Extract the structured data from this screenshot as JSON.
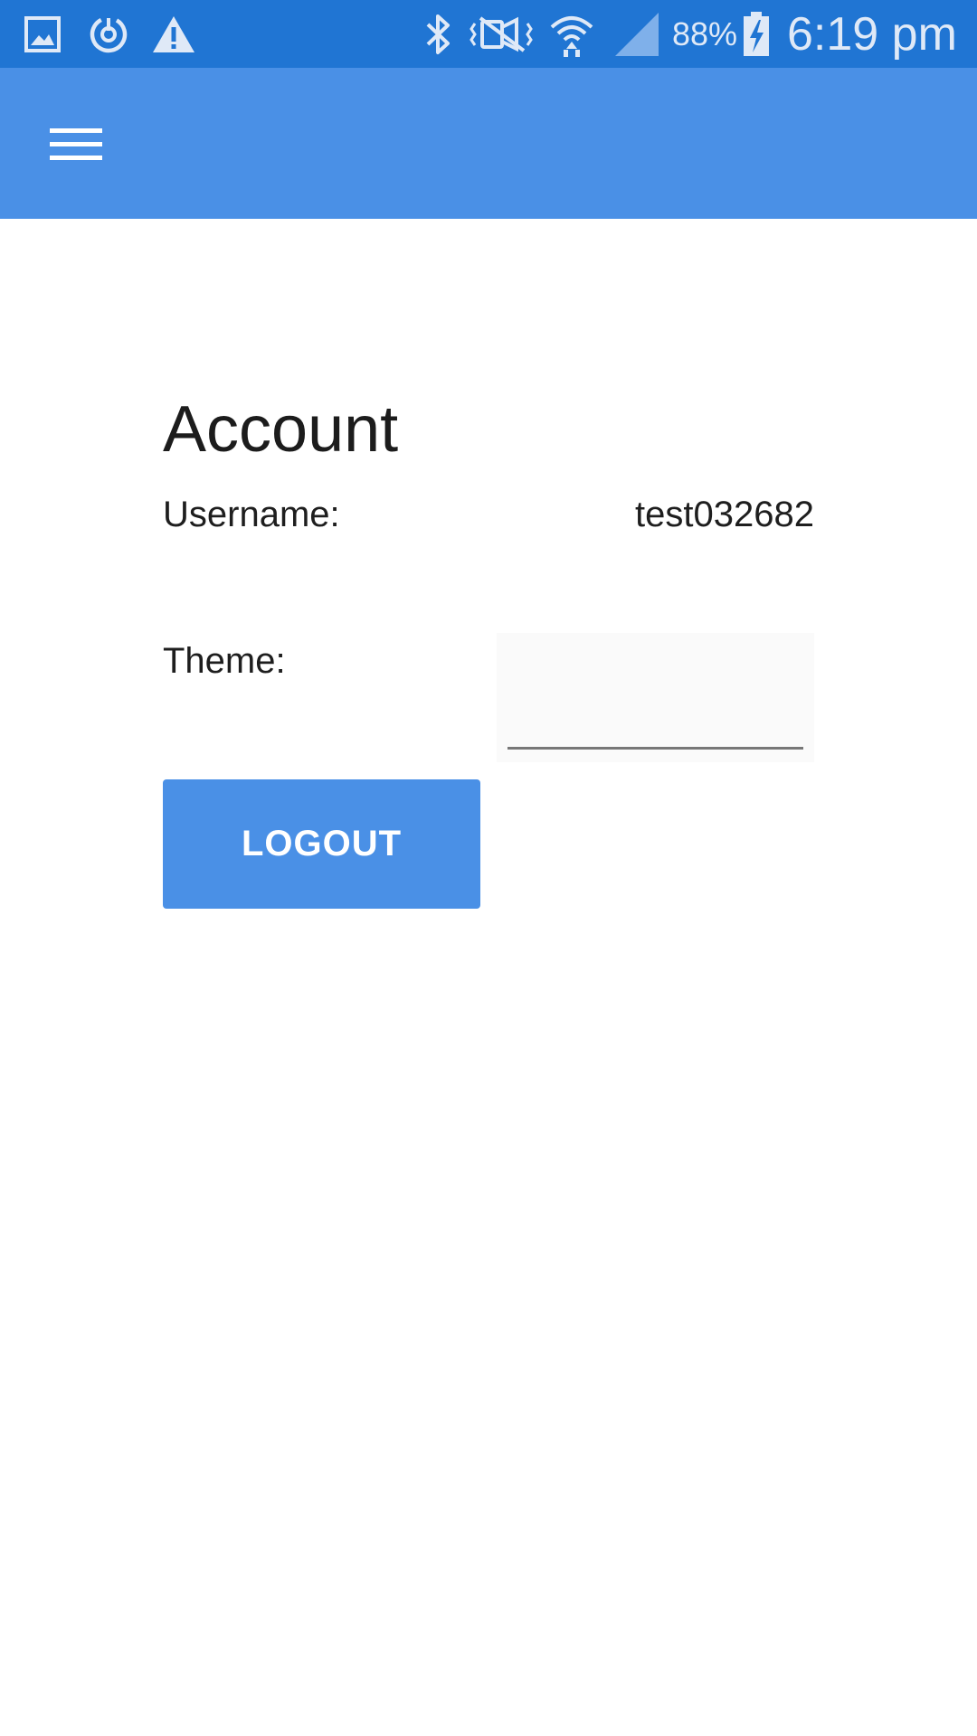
{
  "status_bar": {
    "battery": "88%",
    "time": "6:19 pm",
    "left_icons": [
      "gallery-icon",
      "sync-icon",
      "warning-icon"
    ],
    "right_icons": [
      "bluetooth-icon",
      "vibrate-icon",
      "wifi-icon",
      "signal-icon",
      "battery-charging-icon"
    ],
    "color": "#2075d3"
  },
  "app_bar": {
    "menu_icon": "hamburger-menu-icon",
    "color": "#4a90e6"
  },
  "account": {
    "title": "Account",
    "username_label": "Username:",
    "username_value": "test032682",
    "theme_label": "Theme:",
    "theme_value": "",
    "logout_label": "LOGOUT"
  }
}
